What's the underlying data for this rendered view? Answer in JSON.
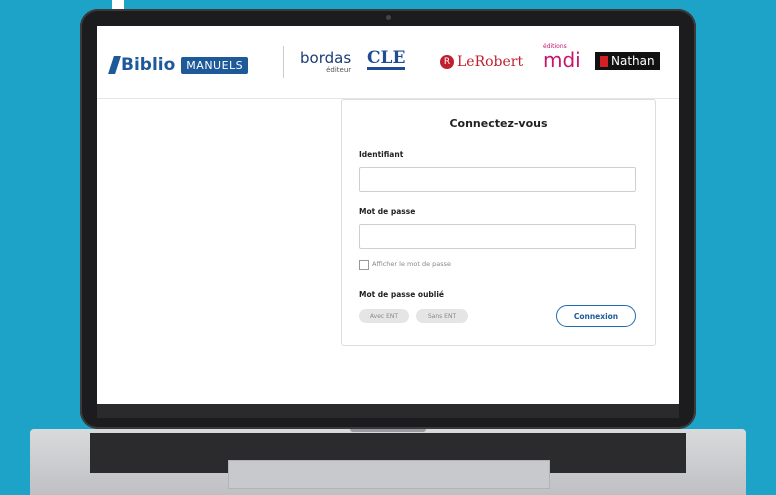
{
  "brand": {
    "biblio": "Biblio",
    "manuels": "MANUELS"
  },
  "publishers": {
    "bordas": "bordas",
    "bordas_sub": "éditeur",
    "cle": "CLE",
    "lerobert": "LeRobert",
    "lerobert_mark": "R",
    "mdi_small": "éditions",
    "mdi": "mdi",
    "nathan": "Nathan"
  },
  "login": {
    "title": "Connectez-vous",
    "identifiant_label": "Identifiant",
    "identifiant_value": "",
    "password_label": "Mot de passe",
    "password_value": "",
    "show_password_label": "Afficher le mot de passe",
    "show_password_checked": false,
    "forgot_label": "Mot de passe oublié",
    "avec_ent": "Avec ENT",
    "sans_ent": "Sans ENT",
    "submit": "Connexion"
  },
  "colors": {
    "background": "#1ea3c8",
    "brand_blue": "#1e5a99",
    "lerobert_red": "#c0202e",
    "mdi_pink": "#c4176b"
  }
}
